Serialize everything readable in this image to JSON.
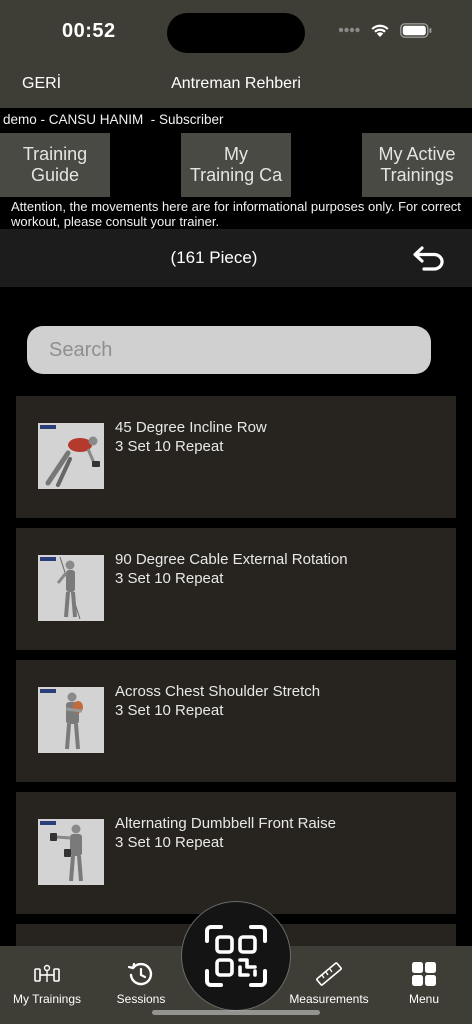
{
  "status": {
    "time": "00:52"
  },
  "nav": {
    "back_label": "GERİ",
    "title": "Antreman Rehberi"
  },
  "user_line": "demo - CANSU HANIM  - Subscriber",
  "tabs": [
    {
      "line1": "Training",
      "line2": "Guide"
    },
    {
      "line1": "My",
      "line2": "Training Ca"
    },
    {
      "line1": "My Active",
      "line2": "Trainings"
    }
  ],
  "notice": "Attention, the movements here are for informational purposes only. For correct workout, please consult your trainer.",
  "count": "(161 Piece)",
  "search": {
    "placeholder": "Search",
    "value": ""
  },
  "exercises": [
    {
      "name": "45 Degree Incline Row",
      "detail": "3 Set 10 Repeat"
    },
    {
      "name": "90 Degree Cable External Rotation",
      "detail": "3 Set 10 Repeat"
    },
    {
      "name": "Across Chest Shoulder Stretch",
      "detail": "3 Set 10 Repeat"
    },
    {
      "name": "Alternating Dumbbell Front Raise",
      "detail": "3 Set 10 Repeat"
    }
  ],
  "tabbar": {
    "my_trainings": "My Trainings",
    "sessions": "Sessions",
    "measurements": "Measurements",
    "menu": "Menu"
  },
  "icons": {
    "wifi": "wifi-icon",
    "battery": "battery-icon",
    "undo": "undo-icon",
    "dumbbell": "dumbbell-icon",
    "history": "history-icon",
    "qr": "qr-scan-icon",
    "ruler": "ruler-icon",
    "grid": "grid-menu-icon"
  }
}
